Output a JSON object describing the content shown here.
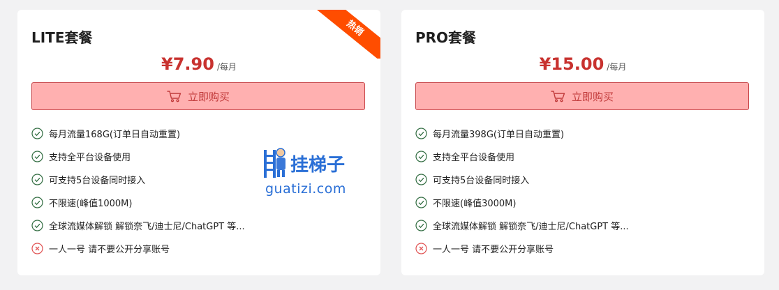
{
  "cards": [
    {
      "name": "LITE套餐",
      "price": "¥7.90",
      "period": "/每月",
      "buy_label": "立即购买",
      "badge": "热销",
      "features": [
        {
          "icon": "check-icon",
          "text": "每月流量168G(订单日自动重置)"
        },
        {
          "icon": "check-icon",
          "text": "支持全平台设备使用"
        },
        {
          "icon": "check-icon",
          "text": "可支持5台设备同时接入"
        },
        {
          "icon": "check-icon",
          "text": "不限速(峰值1000M)"
        },
        {
          "icon": "check-icon",
          "text": "全球流媒体解锁 解锁奈飞/迪士尼/ChatGPT 等..."
        },
        {
          "icon": "cross-icon",
          "text": "一人一号 请不要公开分享账号"
        }
      ]
    },
    {
      "name": "PRO套餐",
      "price": "¥15.00",
      "period": "/每月",
      "buy_label": "立即购买",
      "features": [
        {
          "icon": "check-icon",
          "text": "每月流量398G(订单日自动重置)"
        },
        {
          "icon": "check-icon",
          "text": "支持全平台设备使用"
        },
        {
          "icon": "check-icon",
          "text": "可支持5台设备同时接入"
        },
        {
          "icon": "check-icon",
          "text": "不限速(峰值3000M)"
        },
        {
          "icon": "check-icon",
          "text": "全球流媒体解锁 解锁奈飞/迪士尼/ChatGPT 等..."
        },
        {
          "icon": "cross-icon",
          "text": "一人一号 请不要公开分享账号"
        }
      ]
    }
  ],
  "watermark": {
    "cn": "挂梯子",
    "en": "guatizi.com"
  },
  "colors": {
    "price": "#c8322f",
    "button_bg": "#ffb0b0",
    "button_border": "#c8464a",
    "badge": "#ff4d00",
    "check": "#2f6b3f",
    "cross": "#e05050",
    "watermark": "#2a6fd6"
  }
}
